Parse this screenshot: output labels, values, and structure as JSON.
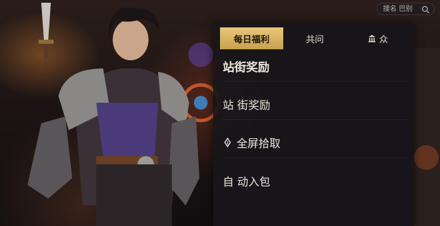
{
  "search": {
    "placeholder": "搜名 巴别"
  },
  "tabs": [
    {
      "label": "每日福利",
      "icon": ""
    },
    {
      "label": "共问",
      "icon": ""
    },
    {
      "label": "众",
      "icon": "temple-icon"
    }
  ],
  "menu": [
    {
      "label": "站街奖励",
      "icon": ""
    },
    {
      "label": "站 街奖励",
      "icon": ""
    },
    {
      "label": "全屏拾取",
      "icon": "pen-nib-icon"
    },
    {
      "label": "自 动入包",
      "icon": ""
    }
  ],
  "colors": {
    "accent": "#d9b564",
    "panel": "#18161a"
  }
}
